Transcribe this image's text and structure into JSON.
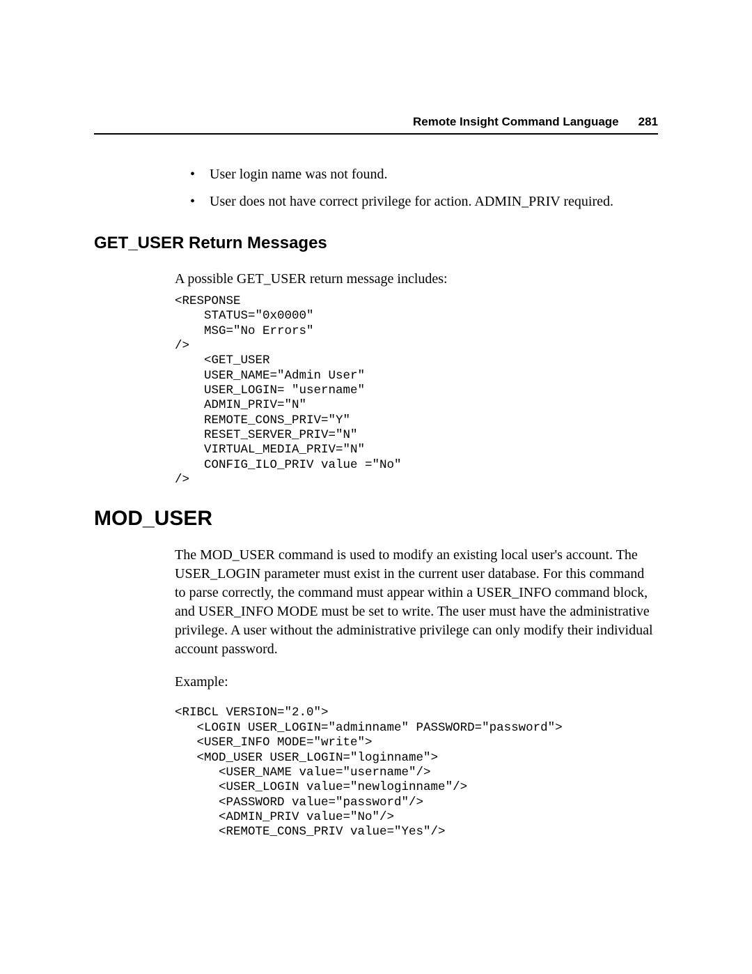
{
  "header": {
    "title": "Remote Insight Command Language",
    "page_number": "281"
  },
  "bullets": {
    "item1": "User login name was not found.",
    "item2": "User does not have correct privilege for action. ADMIN_PRIV required."
  },
  "section1": {
    "heading": "GET_USER Return Messages",
    "intro": "A possible GET_USER return message includes:",
    "code": "<RESPONSE\n    STATUS=\"0x0000\"\n    MSG=\"No Errors\"\n/>\n    <GET_USER\n    USER_NAME=\"Admin User\"\n    USER_LOGIN= \"username\"\n    ADMIN_PRIV=\"N\"\n    REMOTE_CONS_PRIV=\"Y\"\n    RESET_SERVER_PRIV=\"N\"\n    VIRTUAL_MEDIA_PRIV=\"N\"\n    CONFIG_ILO_PRIV value =\"No\"\n/>"
  },
  "section2": {
    "heading": "MOD_USER",
    "para": "The MOD_USER command is used to modify an existing local user's account. The USER_LOGIN parameter must exist in the current user database. For this command to parse correctly, the command must appear within a USER_INFO command block, and USER_INFO MODE must be set to write. The user must have the administrative privilege. A user without the administrative privilege can only modify their individual account password.",
    "example_label": "Example:",
    "code": "<RIBCL VERSION=\"2.0\">\n   <LOGIN USER_LOGIN=\"adminname\" PASSWORD=\"password\">\n   <USER_INFO MODE=\"write\">\n   <MOD_USER USER_LOGIN=\"loginname\">\n      <USER_NAME value=\"username\"/>\n      <USER_LOGIN value=\"newloginname\"/>\n      <PASSWORD value=\"password\"/>\n      <ADMIN_PRIV value=\"No\"/>\n      <REMOTE_CONS_PRIV value=\"Yes\"/>"
  }
}
